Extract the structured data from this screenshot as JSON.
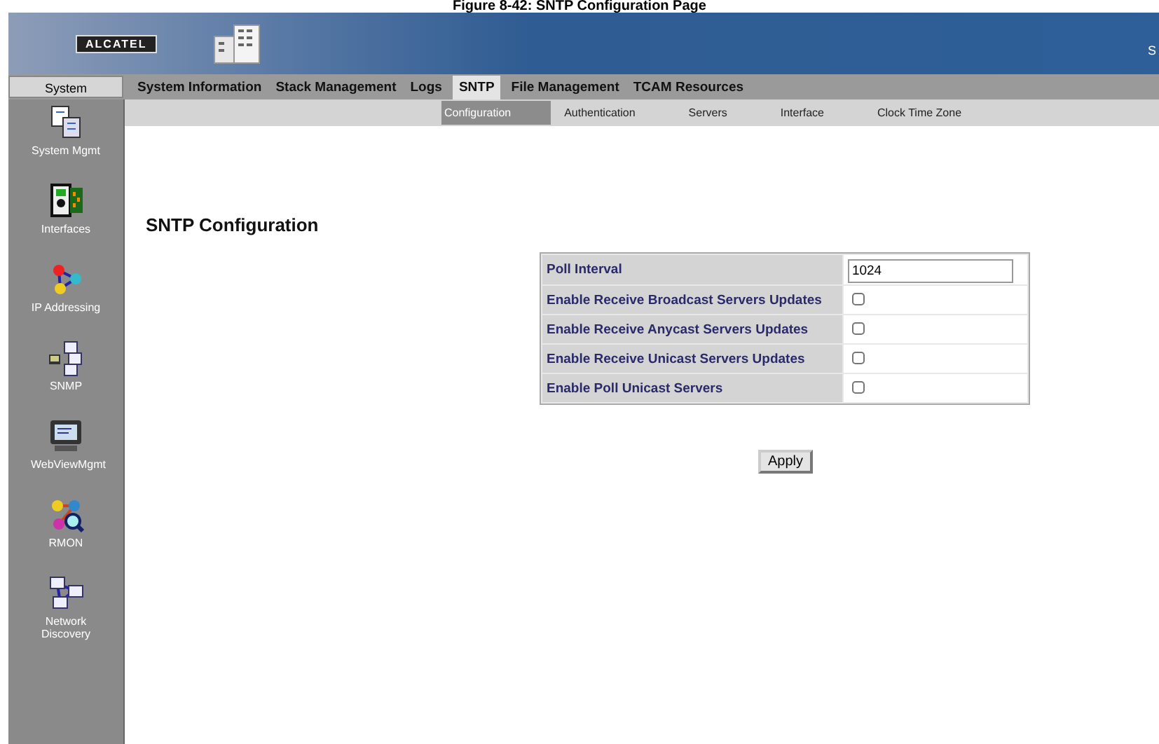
{
  "caption": "Figure 8-42: SNTP Configuration Page",
  "banner": {
    "logo": "ALCATEL",
    "edge_text": "S"
  },
  "sidebar": {
    "header": "System",
    "items": [
      {
        "label": "System Mgmt",
        "kind": "doc"
      },
      {
        "label": "Interfaces",
        "kind": "card"
      },
      {
        "label": "IP Addressing",
        "kind": "triangle"
      },
      {
        "label": "SNMP",
        "kind": "snmp"
      },
      {
        "label": "WebViewMgmt",
        "kind": "monitor"
      },
      {
        "label": "RMON",
        "kind": "rmon"
      },
      {
        "label": "Network Discovery",
        "kind": "network"
      }
    ]
  },
  "tabs": [
    {
      "label": "System Information",
      "selected": false
    },
    {
      "label": "Stack Management",
      "selected": false
    },
    {
      "label": "Logs",
      "selected": false
    },
    {
      "label": "SNTP",
      "selected": true
    },
    {
      "label": "File Management",
      "selected": false
    },
    {
      "label": "TCAM Resources",
      "selected": false
    }
  ],
  "subtabs": [
    {
      "label": "Configuration",
      "selected": true
    },
    {
      "label": "Authentication",
      "selected": false
    },
    {
      "label": "Servers",
      "selected": false
    },
    {
      "label": "Interface",
      "selected": false
    },
    {
      "label": "Clock Time Zone",
      "selected": false
    }
  ],
  "page_title": "SNTP Configuration",
  "fields": [
    {
      "label": "Poll Interval",
      "kind": "text",
      "value": "1024"
    },
    {
      "label": "Enable Receive Broadcast Servers Updates",
      "kind": "checkbox",
      "checked": false
    },
    {
      "label": "Enable Receive Anycast Servers Updates",
      "kind": "checkbox",
      "checked": false
    },
    {
      "label": "Enable Receive Unicast Servers Updates",
      "kind": "checkbox",
      "checked": false
    },
    {
      "label": "Enable Poll Unicast Servers",
      "kind": "checkbox",
      "checked": false
    }
  ],
  "apply_button": "Apply"
}
